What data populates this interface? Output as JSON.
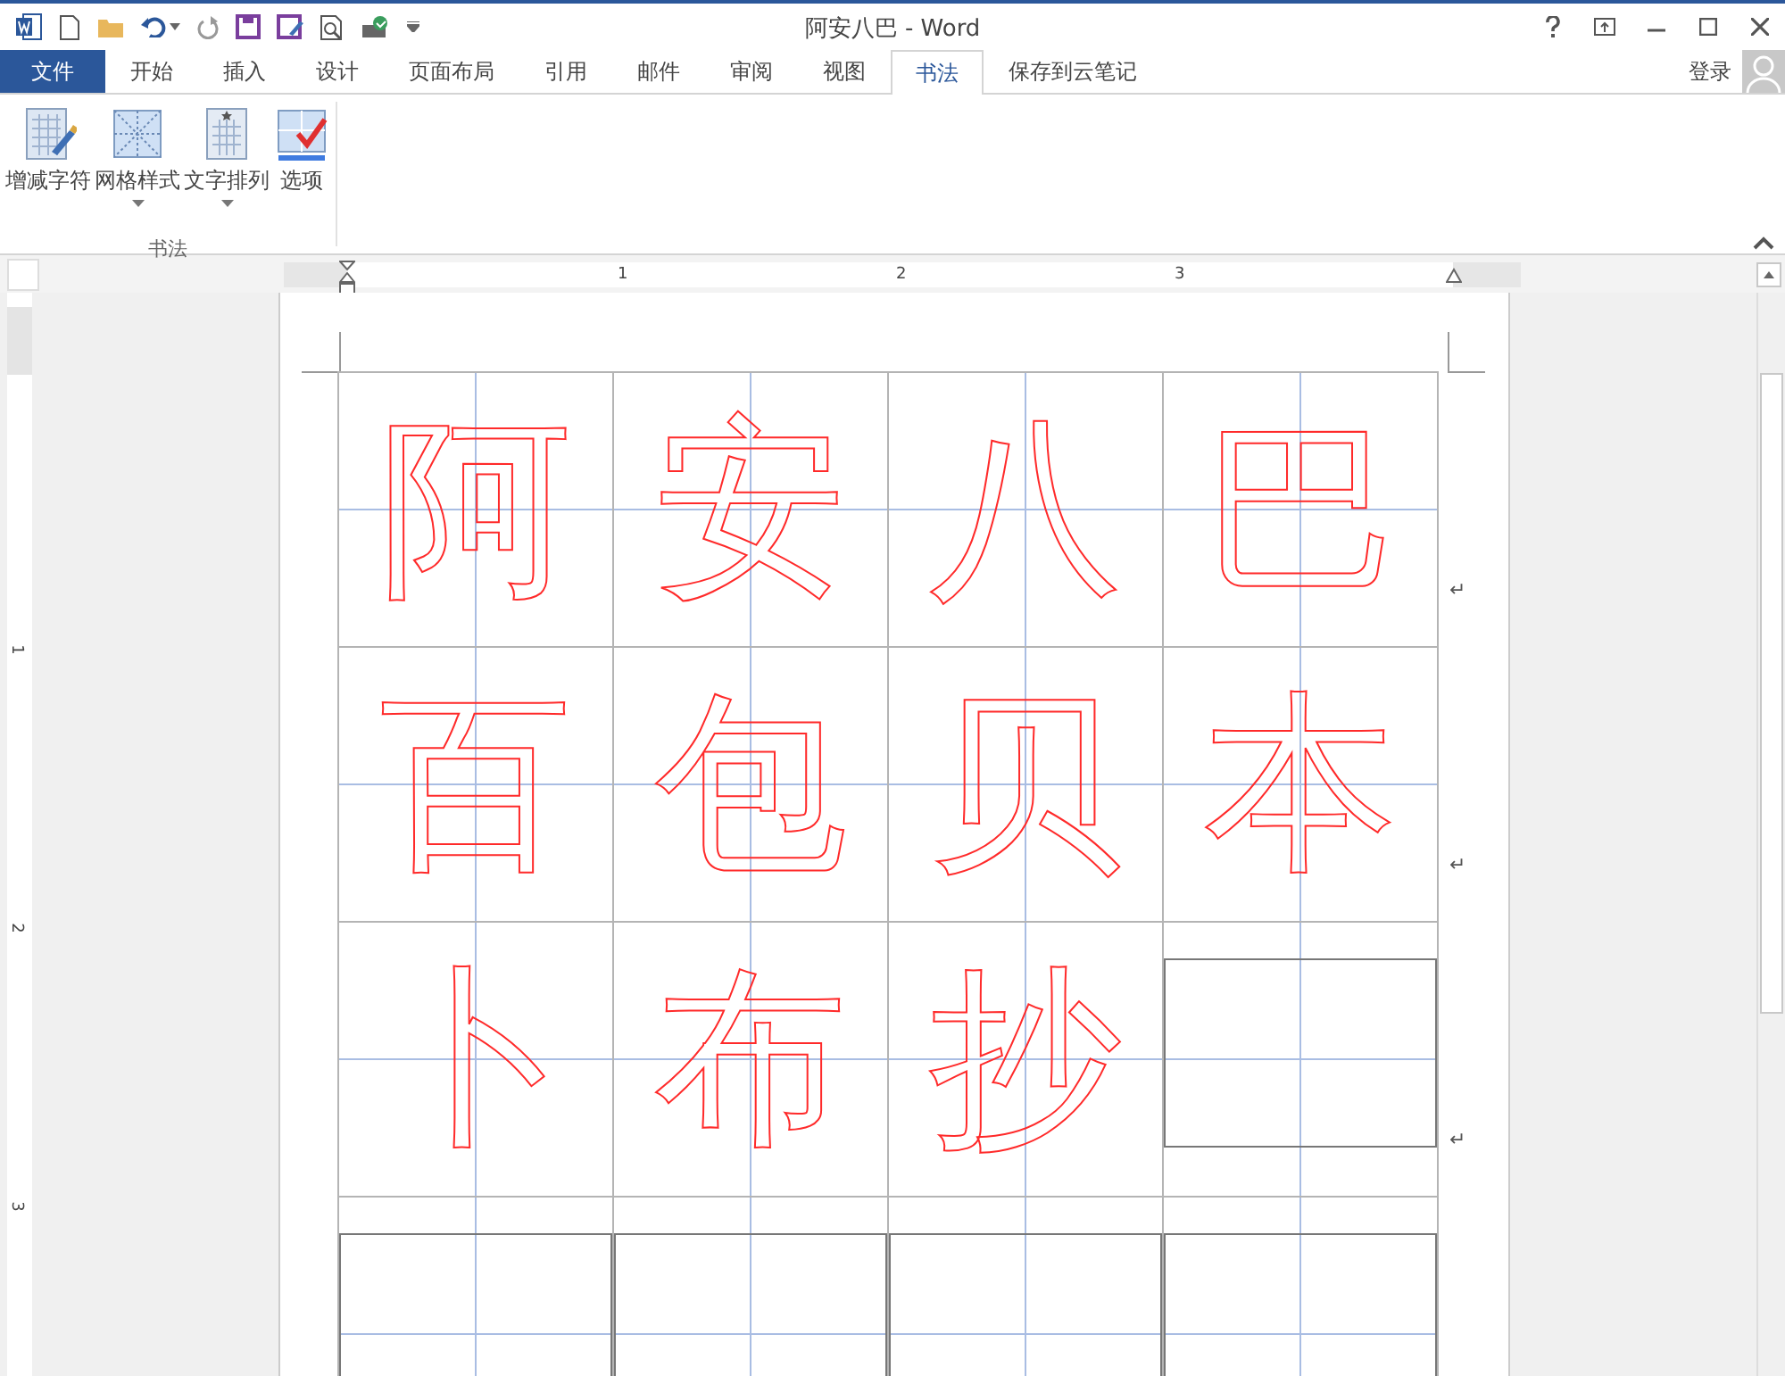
{
  "window": {
    "title": "阿安八巴 - Word"
  },
  "tabs": [
    {
      "label": "文件",
      "kind": "file",
      "selected": false
    },
    {
      "label": "开始",
      "kind": "tab",
      "selected": false
    },
    {
      "label": "插入",
      "kind": "tab",
      "selected": false
    },
    {
      "label": "设计",
      "kind": "tab",
      "selected": false
    },
    {
      "label": "页面布局",
      "kind": "tab",
      "selected": false
    },
    {
      "label": "引用",
      "kind": "tab",
      "selected": false
    },
    {
      "label": "邮件",
      "kind": "tab",
      "selected": false
    },
    {
      "label": "审阅",
      "kind": "tab",
      "selected": false
    },
    {
      "label": "视图",
      "kind": "tab",
      "selected": false
    },
    {
      "label": "书法",
      "kind": "tab",
      "selected": true
    },
    {
      "label": "保存到云笔记",
      "kind": "tab",
      "selected": false
    }
  ],
  "account": {
    "label": "登录"
  },
  "ribbon": {
    "groups": [
      {
        "label": "书法",
        "buttons": [
          {
            "label": "增减字符",
            "kind": "add-chars",
            "dropdown": false
          },
          {
            "label": "网格样式",
            "kind": "grid-style",
            "dropdown": true
          },
          {
            "label": "文字排列",
            "kind": "arrange",
            "dropdown": true
          },
          {
            "label": "选项",
            "kind": "options",
            "dropdown": false
          }
        ]
      }
    ]
  },
  "rulers": {
    "horizontal": [
      "1",
      "2",
      "3"
    ],
    "vertical": [
      "1",
      "2",
      "3"
    ]
  },
  "document": {
    "rows": [
      {
        "cells": [
          {
            "kind": "character",
            "char": "阿"
          },
          {
            "kind": "character",
            "char": "安"
          },
          {
            "kind": "character",
            "char": "八"
          },
          {
            "kind": "character",
            "char": "巴"
          }
        ],
        "paragraph_mark": "↵"
      },
      {
        "cells": [
          {
            "kind": "character",
            "char": "百"
          },
          {
            "kind": "character",
            "char": "包"
          },
          {
            "kind": "character",
            "char": "贝"
          },
          {
            "kind": "character",
            "char": "本"
          }
        ],
        "paragraph_mark": "↵"
      },
      {
        "cells": [
          {
            "kind": "character",
            "char": "卜"
          },
          {
            "kind": "character",
            "char": "布"
          },
          {
            "kind": "character",
            "char": "抄"
          },
          {
            "kind": "box"
          }
        ],
        "paragraph_mark": "↵"
      },
      {
        "cells": [
          {
            "kind": "box"
          },
          {
            "kind": "box"
          },
          {
            "kind": "box"
          },
          {
            "kind": "box"
          }
        ]
      }
    ]
  }
}
